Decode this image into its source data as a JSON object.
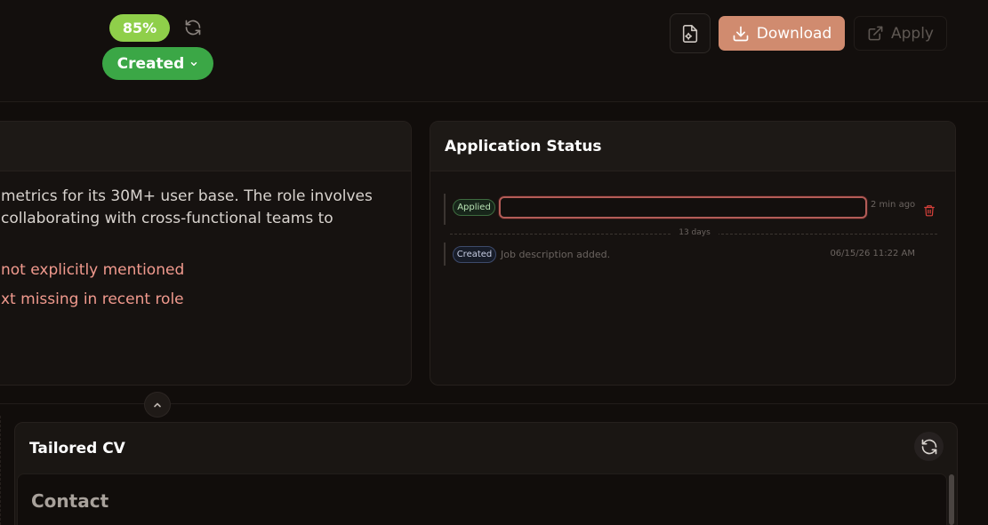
{
  "header": {
    "match_score": "85%",
    "status_label": "Created",
    "icons": {
      "refresh": "refresh-icon",
      "chevron": "chevron-down-icon",
      "file_settings": "file-settings-icon",
      "download": "download-icon",
      "external_link": "external-link-icon"
    },
    "download_label": "Download",
    "apply_label": "Apply"
  },
  "job_panel": {
    "description_lines": [
      "metrics for its 30M+ user base. The role involves",
      "collaborating with cross-functional teams to"
    ],
    "gaps": [
      "not explicitly mentioned",
      "xt missing in recent role"
    ]
  },
  "application_status": {
    "title": "Application Status",
    "entries": [
      {
        "badge": "Applied",
        "note_value": "",
        "time": "2 min ago"
      },
      {
        "badge": "Created",
        "text": "Job description added.",
        "time": "06/15/26 11:22 AM"
      }
    ],
    "interval_label": "13 days"
  },
  "tailored_cv": {
    "title": "Tailored CV",
    "section_heading": "Contact"
  },
  "colors": {
    "background": "#110d0b",
    "score_badge": "#8fcf4a",
    "status_green": "#3ba746",
    "download_accent": "#d08b6f",
    "gap_text": "#f19a8e",
    "input_focus_border": "#b35c57",
    "delete_red": "#d9413b"
  }
}
